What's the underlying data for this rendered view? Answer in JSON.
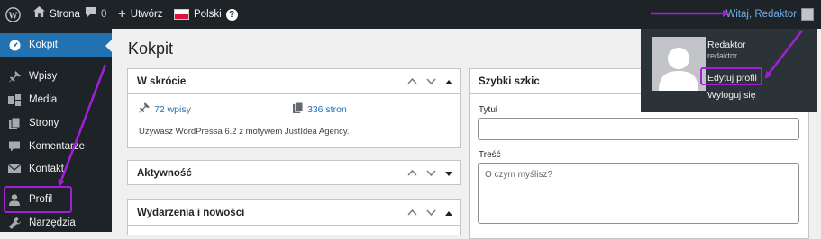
{
  "admin_bar": {
    "site_name": "Strona",
    "comments_count": "0",
    "new_label": "Utwórz",
    "language": "Polski",
    "help": "?",
    "account_greeting": "Witaj, Redaktor"
  },
  "sidebar": {
    "items": [
      {
        "label": "Kokpit",
        "icon": "dashboard-icon"
      },
      {
        "label": "Wpisy",
        "icon": "pin-icon"
      },
      {
        "label": "Media",
        "icon": "media-icon"
      },
      {
        "label": "Strony",
        "icon": "page-icon"
      },
      {
        "label": "Komentarze",
        "icon": "comment-icon"
      },
      {
        "label": "Kontakt",
        "icon": "mail-icon"
      },
      {
        "label": "Profil",
        "icon": "user-icon"
      },
      {
        "label": "Narzędzia",
        "icon": "wrench-icon"
      }
    ]
  },
  "main": {
    "title": "Kokpit",
    "glance": {
      "title": "W skrócie",
      "posts": "72 wpisy",
      "pages": "336 stron",
      "theme_text": "Używasz WordPressa 6.2 z motywem JustIdea Agency."
    },
    "activity": {
      "title": "Aktywność"
    },
    "events": {
      "title": "Wydarzenia i nowości"
    },
    "quick_draft": {
      "title": "Szybki szkic",
      "title_label": "Tytuł",
      "content_label": "Treść",
      "content_placeholder": "O czym myślisz?"
    }
  },
  "account_dropdown": {
    "display_name": "Redaktor",
    "username": "redaktor",
    "edit_profile": "Edytuj profil",
    "logout": "Wyloguj się"
  },
  "colors": {
    "admin_bar_bg": "#1d2327",
    "accent": "#2271b1",
    "annotation": "#a21fd9"
  }
}
